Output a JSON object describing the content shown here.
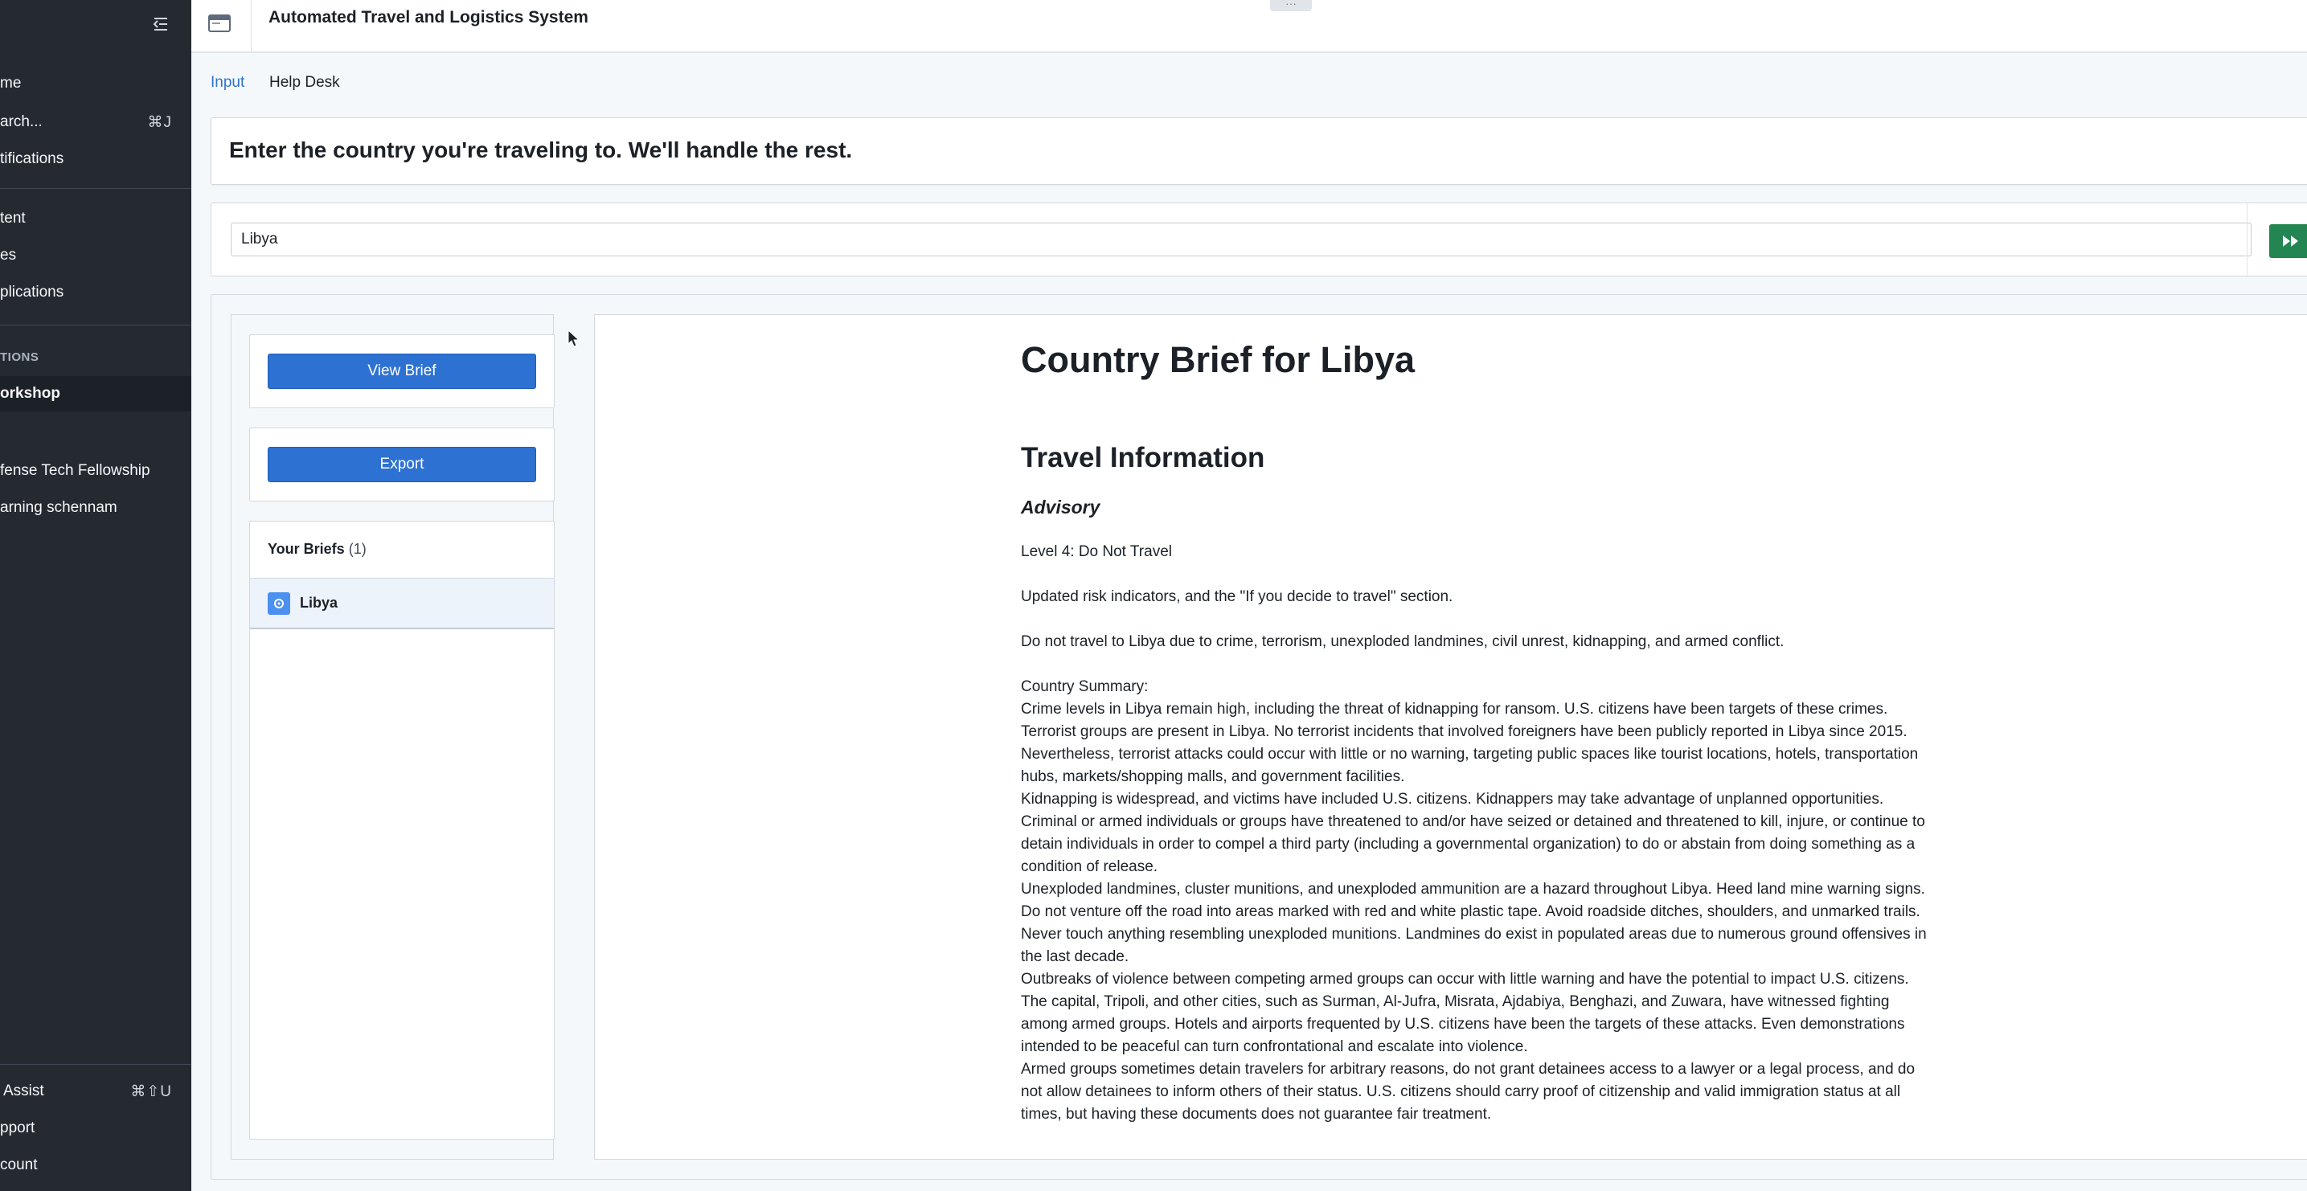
{
  "sidebar": {
    "items": [
      {
        "label": "me",
        "shortcut": ""
      },
      {
        "label": "arch...",
        "shortcut": "⌘J"
      },
      {
        "label": "tifications",
        "shortcut": ""
      },
      {
        "label": "tent",
        "shortcut": ""
      },
      {
        "label": "es",
        "shortcut": ""
      },
      {
        "label": "plications",
        "shortcut": ""
      }
    ],
    "section_label": "TIONS",
    "active_item": "orkshop",
    "projects": [
      {
        "label": "fense Tech Fellowship"
      },
      {
        "label": "arning schennam"
      }
    ],
    "bottom": [
      {
        "label": "Assist",
        "shortcut": "⌘⇧U"
      },
      {
        "label": "pport",
        "shortcut": ""
      },
      {
        "label": "count",
        "shortcut": ""
      }
    ]
  },
  "header": {
    "title": "Automated Travel and Logistics System",
    "grab_handle": "···"
  },
  "tabs": [
    {
      "label": "Input",
      "active": true
    },
    {
      "label": "Help Desk",
      "active": false
    }
  ],
  "prompt": {
    "heading": "Enter the country you're traveling to. We'll handle the rest."
  },
  "search": {
    "value": "Libya"
  },
  "actions": {
    "view_brief": "View Brief",
    "export": "Export"
  },
  "briefs": {
    "title": "Your Briefs",
    "count": "(1)",
    "items": [
      {
        "name": "Libya"
      }
    ]
  },
  "document": {
    "title": "Country Brief for Libya",
    "section": "Travel Information",
    "subsection": "Advisory",
    "level": "Level 4: Do Not Travel",
    "updated": "Updated risk indicators, and the \"If you decide to travel\" section.",
    "warning": "Do not travel to Libya due to crime, terrorism, unexploded landmines, civil unrest, kidnapping, and armed conflict.",
    "summary_label": "Country Summary:",
    "paragraphs": [
      "Crime levels in Libya remain high, including the threat of kidnapping for ransom. U.S. citizens have been targets of these crimes.",
      "Terrorist groups are present in Libya. No terrorist incidents that involved foreigners have been publicly reported in Libya since 2015. Nevertheless, terrorist attacks could occur with little or no warning, targeting public spaces like tourist locations, hotels, transportation hubs, markets/shopping malls, and government facilities.",
      "Kidnapping is widespread, and victims have included U.S. citizens. Kidnappers may take advantage of unplanned opportunities. Criminal or armed individuals or groups have threatened to and/or have seized or detained and threatened to kill, injure, or continue to detain individuals in order to compel a third party (including a governmental organization) to do or abstain from doing something as a condition of release.",
      "Unexploded landmines, cluster munitions, and unexploded ammunition are a hazard throughout Libya. Heed land mine warning signs. Do not venture off the road into areas marked with red and white plastic tape. Avoid roadside ditches, shoulders, and unmarked trails. Never touch anything resembling unexploded munitions. Landmines do exist in populated areas due to numerous ground offensives in the last decade.",
      "Outbreaks of violence between competing armed groups can occur with little warning and have the potential to impact U.S. citizens. The capital, Tripoli, and other cities, such as Surman, Al-Jufra, Misrata, Ajdabiya, Benghazi, and Zuwara, have witnessed fighting among armed groups. Hotels and airports frequented by U.S. citizens have been the targets of these attacks. Even demonstrations intended to be peaceful can turn confrontational and escalate into violence.",
      "Armed groups sometimes detain travelers for arbitrary reasons, do not grant detainees access to a lawyer or a legal process, and do not allow detainees to inform others of their status. U.S. citizens should carry proof of citizenship and valid immigration status at all times, but having these documents does not guarantee fair treatment."
    ]
  },
  "colors": {
    "sidebar_bg": "#252a31",
    "primary": "#2d72d2",
    "run_button": "#238551",
    "active_tab": "#2d72d2"
  }
}
